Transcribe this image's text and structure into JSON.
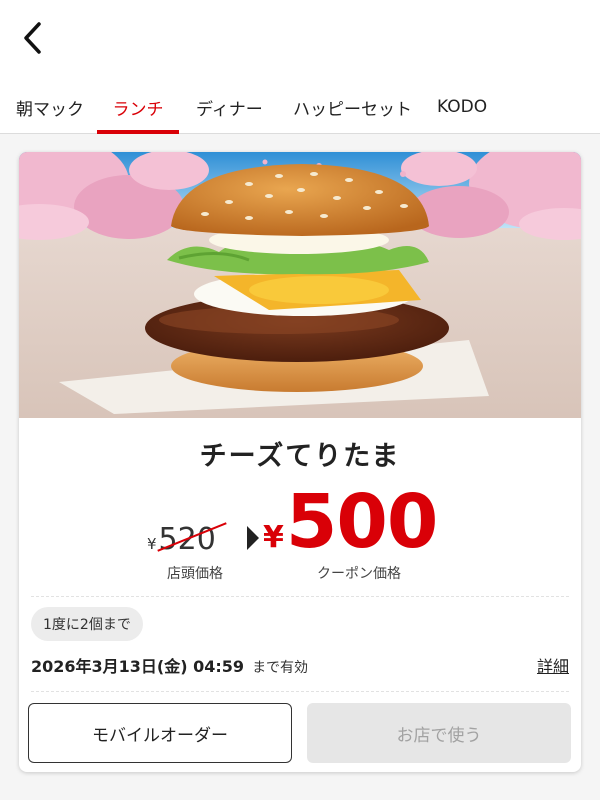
{
  "nav": {
    "back_icon": "chevron-left-icon",
    "tabs": [
      {
        "label": "朝マック",
        "active": false
      },
      {
        "label": "ランチ",
        "active": true
      },
      {
        "label": "ディナー",
        "active": false
      },
      {
        "label": "ハッピーセット",
        "active": false
      },
      {
        "label": "KODO",
        "active": false
      }
    ]
  },
  "coupon": {
    "product_name": "チーズてりたま",
    "store_price": {
      "currency": "¥",
      "amount": "520",
      "label": "店頭価格"
    },
    "coupon_price": {
      "currency": "¥",
      "amount": "500",
      "label": "クーポン価格"
    },
    "limit": "1度に2個まで",
    "expiry": {
      "date": "2026年3月13日(金) 04:59",
      "suffix": "まで有効"
    },
    "detail_link": "詳細",
    "buttons": {
      "mobile_order": "モバイルオーダー",
      "use_in_store": "お店で使う"
    }
  },
  "colors": {
    "accent": "#d90007",
    "disabled_text": "#a2a2a2"
  }
}
